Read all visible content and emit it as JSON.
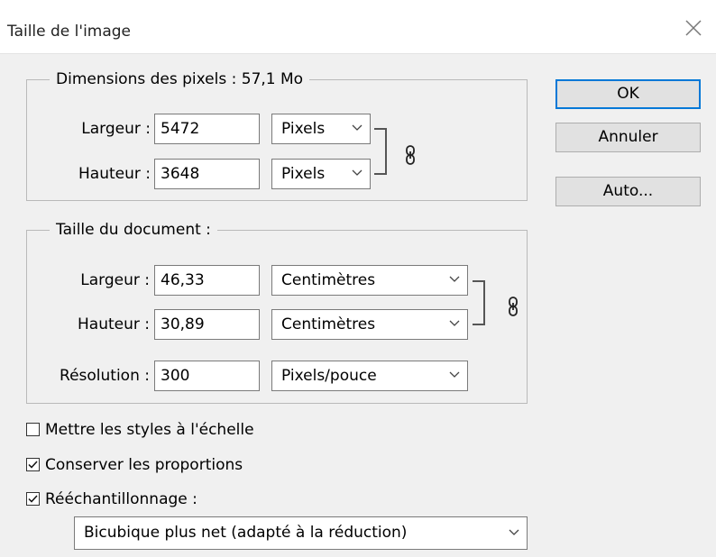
{
  "window": {
    "title": "Taille de l'image"
  },
  "pixel_dimensions": {
    "legend": "Dimensions des pixels : 57,1 Mo",
    "width_label": "Largeur :",
    "width_value": "5472",
    "width_unit": "Pixels",
    "height_label": "Hauteur :",
    "height_value": "3648",
    "height_unit": "Pixels"
  },
  "document_size": {
    "legend": "Taille du document :",
    "width_label": "Largeur :",
    "width_value": "46,33",
    "width_unit": "Centimètres",
    "height_label": "Hauteur :",
    "height_value": "30,89",
    "height_unit": "Centimètres",
    "resolution_label": "Résolution :",
    "resolution_value": "300",
    "resolution_unit": "Pixels/pouce"
  },
  "buttons": {
    "ok": "OK",
    "cancel": "Annuler",
    "auto": "Auto..."
  },
  "options": {
    "scale_styles": {
      "label": "Mettre les styles à l'échelle",
      "checked": false
    },
    "constrain": {
      "label": "Conserver les proportions",
      "checked": true
    },
    "resample": {
      "label": "Rééchantillonnage :",
      "checked": true
    }
  },
  "resample_method": "Bicubique plus net (adapté à la réduction)",
  "icons": [
    "close-icon",
    "chain-link-icon",
    "chevron-down-icon",
    "checkmark-icon"
  ],
  "colors": {
    "default_button_border": "#0078d7",
    "background": "#f0f0f0"
  }
}
